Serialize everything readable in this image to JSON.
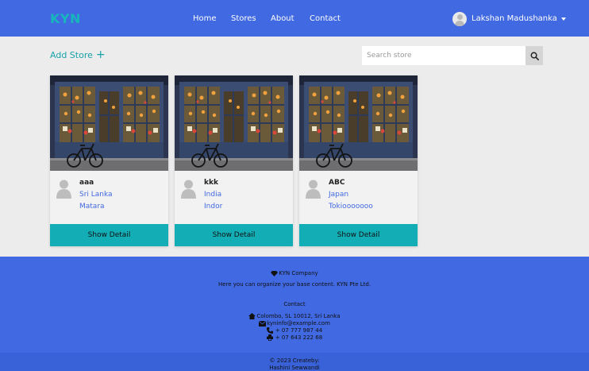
{
  "navbar": {
    "brand": "KYN",
    "links": [
      "Home",
      "Stores",
      "About",
      "Contact"
    ],
    "user_name": "Lakshan Madushanka",
    "accent_color": "#4169e1",
    "brand_color": "#17b6bd"
  },
  "toolbar": {
    "add_store_label": "Add Store",
    "add_icon": "+",
    "search_placeholder": "Search store"
  },
  "stores": [
    {
      "name": "aaa",
      "country": "Sri Lanka",
      "city": "Matara",
      "button_label": "Show Detail"
    },
    {
      "name": "kkk",
      "country": "India",
      "city": "Indor",
      "button_label": "Show Detail"
    },
    {
      "name": "ABC",
      "country": "Japan",
      "city": "Tokiooooooo",
      "button_label": "Show Detail"
    }
  ],
  "footer": {
    "company": "KYN Company",
    "description": "Here you can organize your base content. KYN Pte Ltd.",
    "contact_heading": "Contact",
    "address": "Colombo, SL 10012, Sri Lanka",
    "email": "kyninfo@example.com",
    "phone": "+ 07 777 987 44",
    "fax": "+ 07 643 222 68",
    "copyright_line1": "© 2023 Createby:",
    "copyright_line2": "Hashini Sewwandi"
  }
}
